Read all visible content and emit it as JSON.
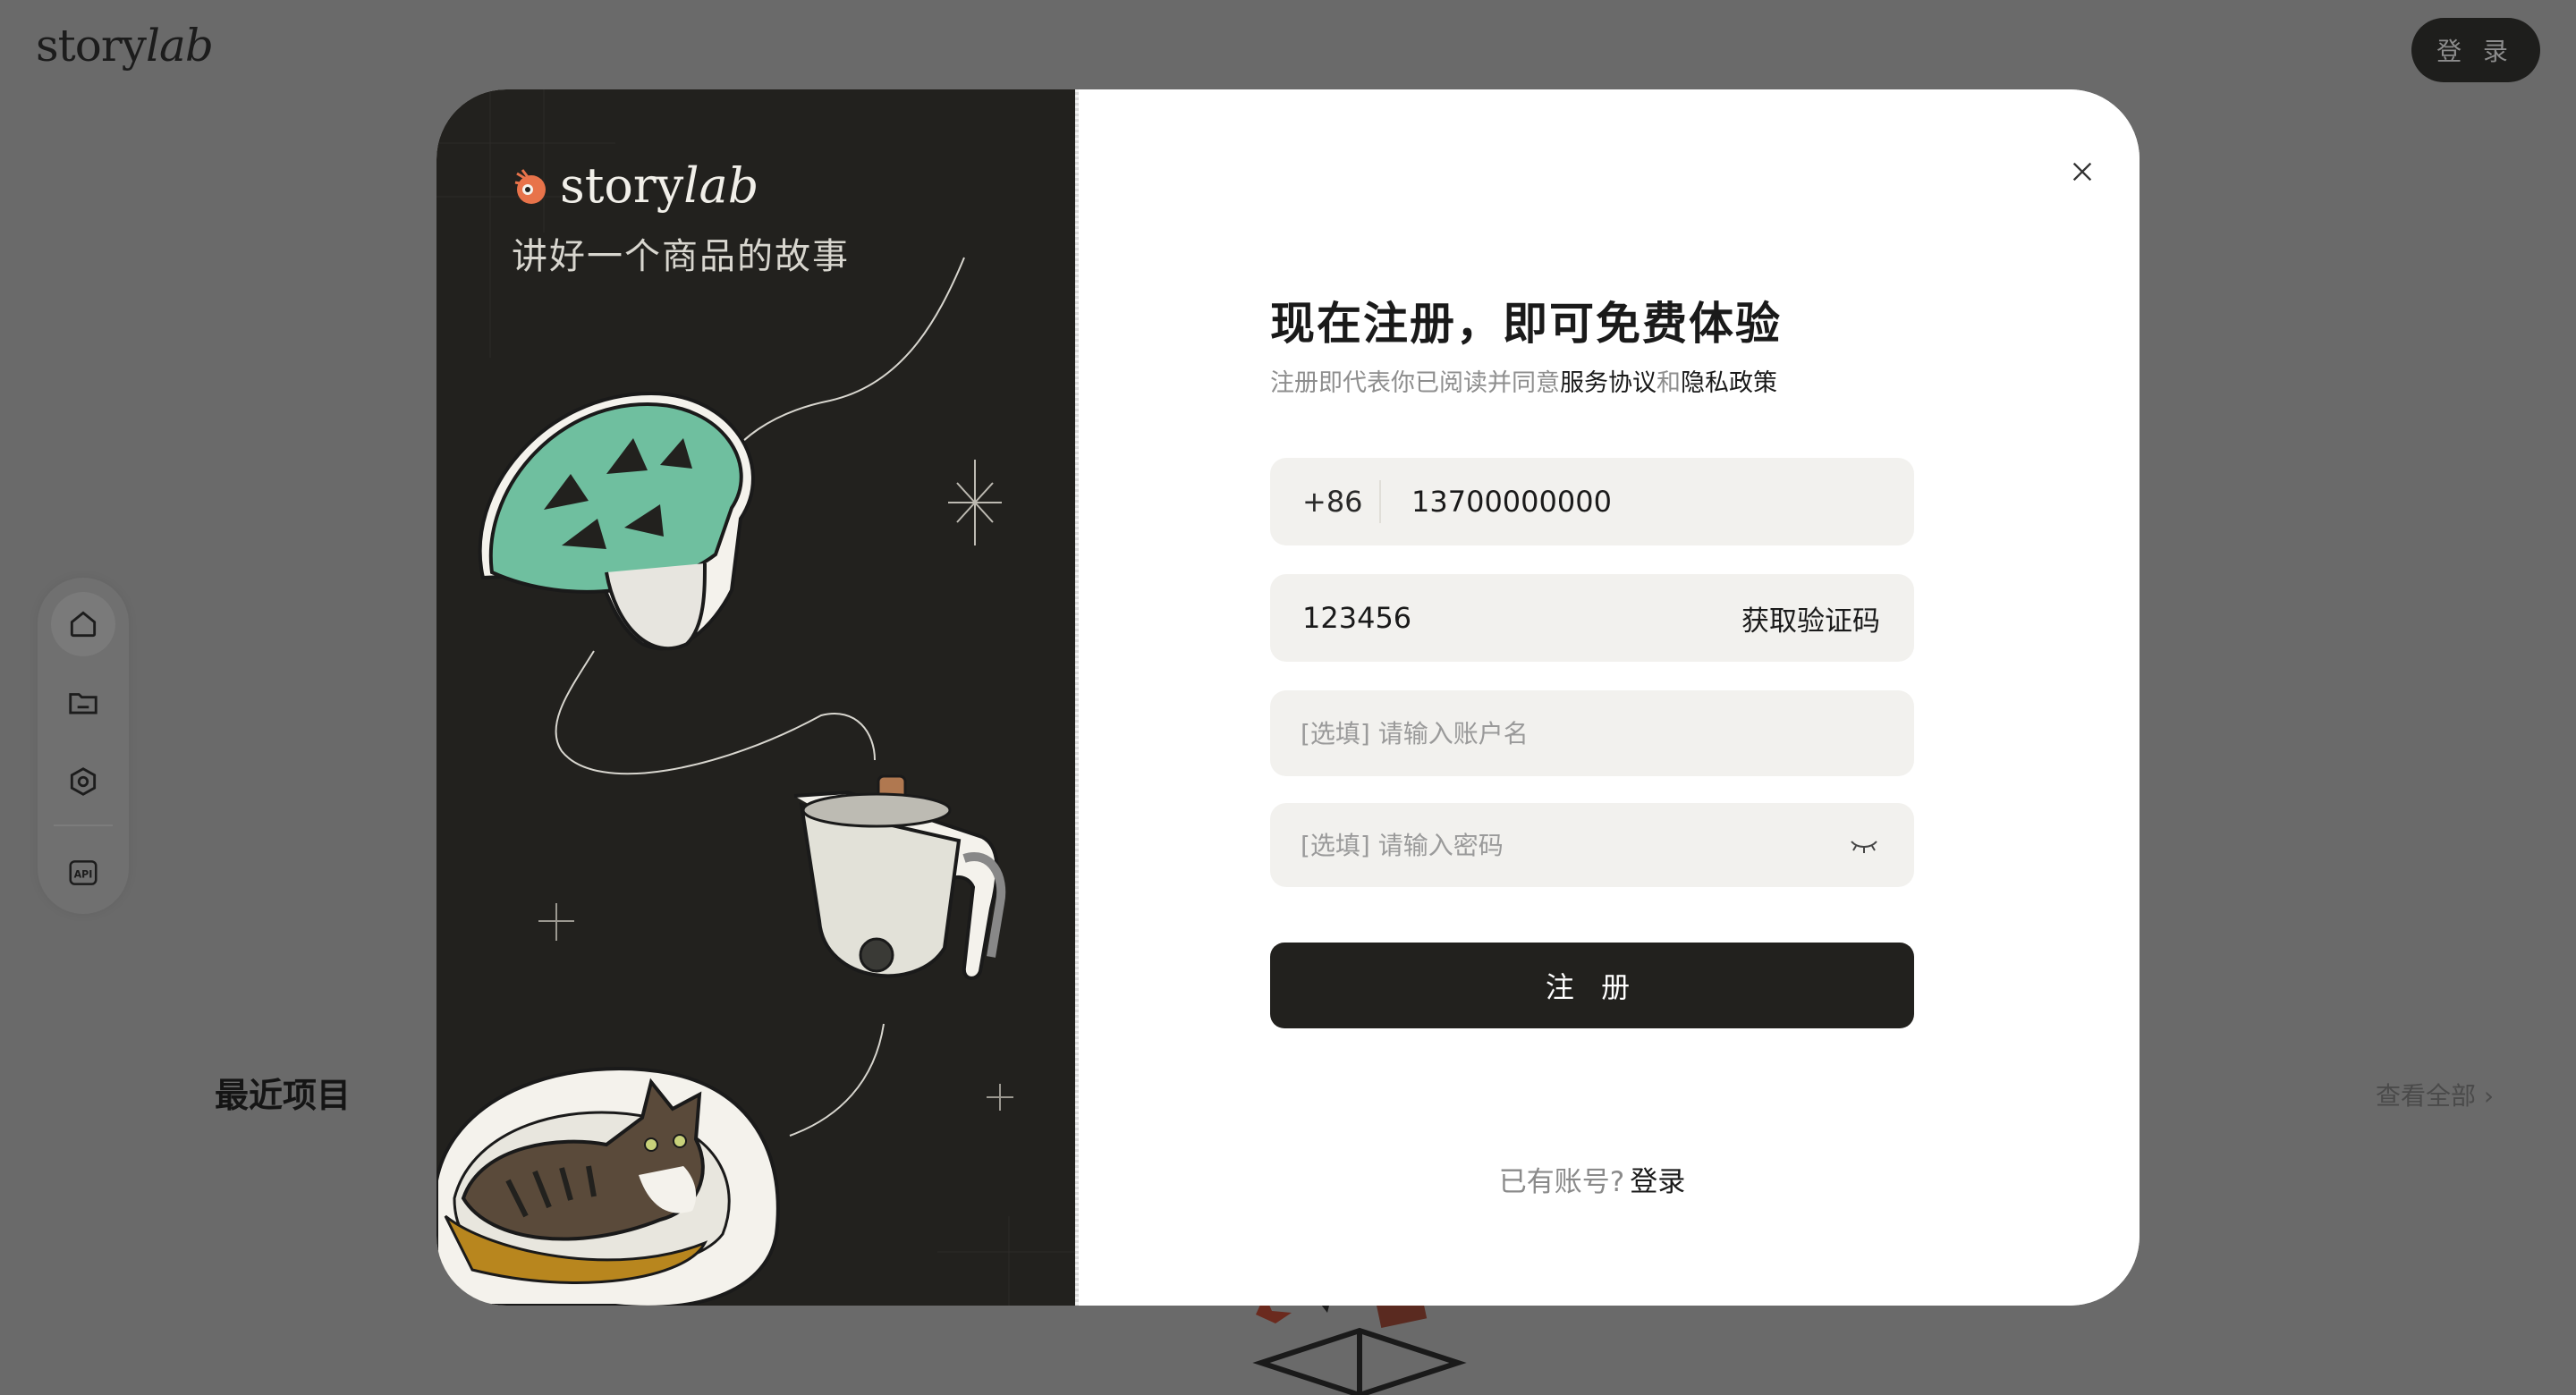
{
  "background": {
    "logo": {
      "plain": "story",
      "italic": "lab"
    },
    "login_button": "登 录",
    "side_rail": [
      {
        "icon": "home-icon",
        "active": true
      },
      {
        "icon": "folder-icon",
        "active": false
      },
      {
        "icon": "settings-hex-icon",
        "active": false
      },
      {
        "icon": "api-icon",
        "active": false
      }
    ],
    "recent_title": "最近项目",
    "view_all": "查看全部 ›"
  },
  "modal": {
    "brand": {
      "plain": "story",
      "italic": "lab"
    },
    "tagline": "讲好一个商品的故事",
    "title": "现在注册，即可免费体验",
    "subtitle": {
      "prefix": "注册即代表你已阅读并同意",
      "terms": "服务协议",
      "and": "和",
      "privacy": "隐私政策"
    },
    "phone": {
      "country_code": "+86",
      "value": "13700000000"
    },
    "code": {
      "value": "123456",
      "get_code_label": "获取验证码"
    },
    "username": {
      "placeholder": "[选填] 请输入账户名"
    },
    "password": {
      "placeholder": "[选填] 请输入密码"
    },
    "submit_label": "注 册",
    "login_prompt": {
      "text": "已有账号?",
      "link": "登录"
    }
  },
  "colors": {
    "overlay_bg": "#6a6a6a",
    "panel_dark": "#22211e",
    "field_bg": "#f2f1ee",
    "helmet": "#6fbf9f",
    "brand_accent": "#e8734a",
    "cat_bed_gold": "#b8861e"
  }
}
